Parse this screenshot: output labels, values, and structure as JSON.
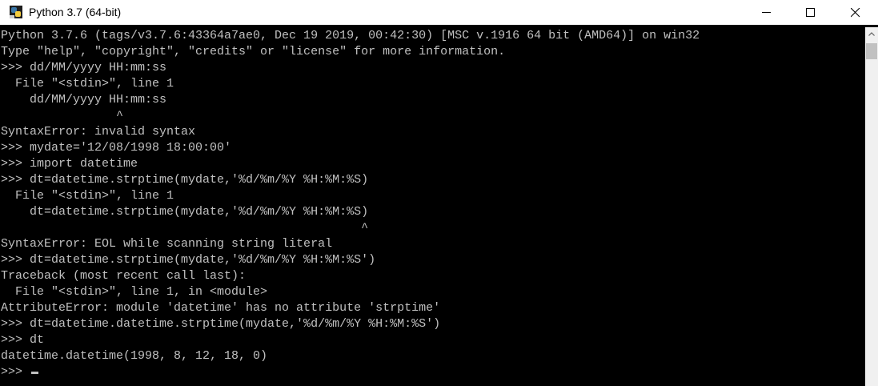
{
  "window": {
    "title": "Python 3.7 (64-bit)"
  },
  "icons": {
    "app": "python-icon",
    "minimize": "minimize-icon",
    "maximize": "maximize-icon",
    "close": "close-icon",
    "scroll_up": "chevron-up-icon"
  },
  "colors": {
    "console_background": "#000000",
    "console_text": "#c0c0c0",
    "titlebar_background": "#ffffff"
  },
  "console": {
    "lines": [
      "Python 3.7.6 (tags/v3.7.6:43364a7ae0, Dec 19 2019, 00:42:30) [MSC v.1916 64 bit (AMD64)] on win32",
      "Type \"help\", \"copyright\", \"credits\" or \"license\" for more information.",
      ">>> dd/MM/yyyy HH:mm:ss",
      "  File \"<stdin>\", line 1",
      "    dd/MM/yyyy HH:mm:ss",
      "                ^",
      "SyntaxError: invalid syntax",
      ">>> mydate='12/08/1998 18:00:00'",
      ">>> import datetime",
      ">>> dt=datetime.strptime(mydate,'%d/%m/%Y %H:%M:%S)",
      "  File \"<stdin>\", line 1",
      "    dt=datetime.strptime(mydate,'%d/%m/%Y %H:%M:%S)",
      "                                                  ^",
      "SyntaxError: EOL while scanning string literal",
      ">>> dt=datetime.strptime(mydate,'%d/%m/%Y %H:%M:%S')",
      "Traceback (most recent call last):",
      "  File \"<stdin>\", line 1, in <module>",
      "AttributeError: module 'datetime' has no attribute 'strptime'",
      ">>> dt=datetime.datetime.strptime(mydate,'%d/%m/%Y %H:%M:%S')",
      ">>> dt",
      "datetime.datetime(1998, 8, 12, 18, 0)"
    ],
    "prompt": ">>>"
  }
}
